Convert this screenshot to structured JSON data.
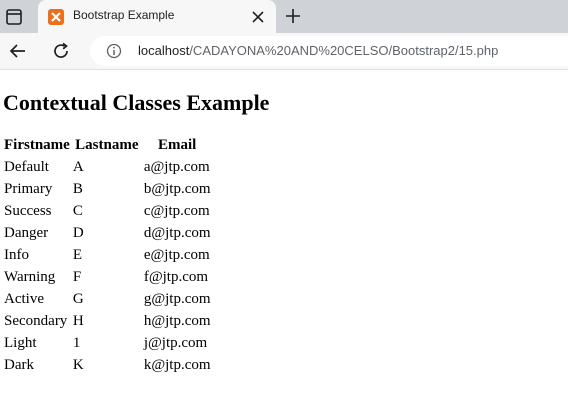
{
  "browser": {
    "tab_title": "Bootstrap Example",
    "url_host": "localhost",
    "url_path": "/CADAYONA%20AND%20CELSO/Bootstrap2/15.php",
    "favicon_color": "#e8701e"
  },
  "page": {
    "heading": "Contextual Classes Example",
    "table": {
      "headers": [
        "Firstname",
        "Lastname",
        "Email"
      ],
      "rows": [
        [
          "Default",
          "A",
          "a@jtp.com"
        ],
        [
          "Primary",
          "B",
          "b@jtp.com"
        ],
        [
          "Success",
          "C",
          "c@jtp.com"
        ],
        [
          "Danger",
          "D",
          "d@jtp.com"
        ],
        [
          "Info",
          "E",
          "e@jtp.com"
        ],
        [
          "Warning",
          "F",
          "f@jtp.com"
        ],
        [
          "Active",
          "G",
          "g@jtp.com"
        ],
        [
          "Secondary",
          "H",
          "h@jtp.com"
        ],
        [
          "Light",
          "1",
          "j@jtp.com"
        ],
        [
          "Dark",
          "K",
          "k@jtp.com"
        ]
      ]
    }
  }
}
